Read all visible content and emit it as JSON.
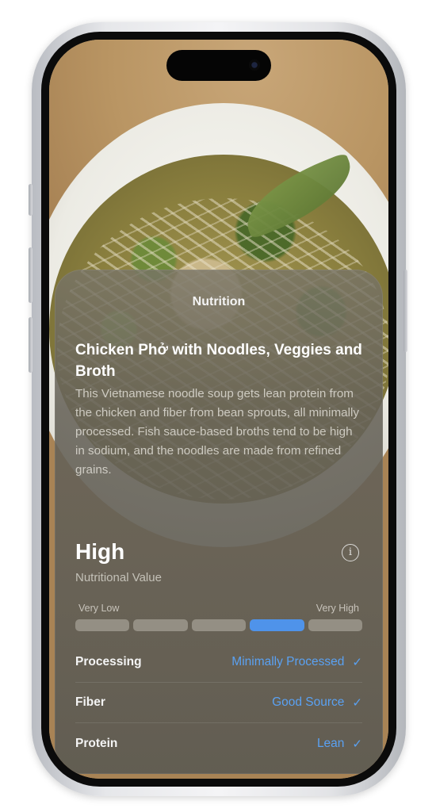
{
  "card": {
    "header": "Nutrition",
    "dish_title": "Chicken Phở with Noodles, Veggies and Broth",
    "description": "This Vietnamese noodle soup gets lean protein from the chicken and fiber from bean sprouts, all minimally processed. Fish sauce-based broths tend to be high in sodium, and the noodles are made from refined grains.",
    "rating_value": "High",
    "rating_label": "Nutritional Value",
    "info_icon": "info-icon",
    "scale": {
      "low_label": "Very Low",
      "high_label": "Very High",
      "segments": 5,
      "active_index": 3
    },
    "rows": [
      {
        "label": "Processing",
        "value": "Minimally Processed",
        "icon": "checkmark-icon"
      },
      {
        "label": "Fiber",
        "value": "Good Source",
        "icon": "checkmark-icon"
      },
      {
        "label": "Protein",
        "value": "Lean",
        "icon": "checkmark-icon"
      }
    ]
  },
  "colors": {
    "accent": "#4f93ea",
    "value_text": "#5aa1f2"
  }
}
